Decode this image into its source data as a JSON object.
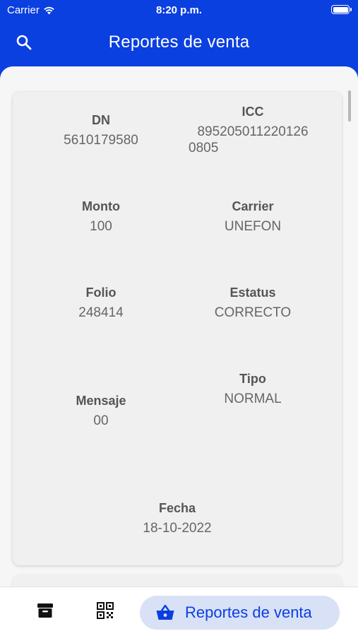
{
  "status_bar": {
    "carrier": "Carrier",
    "time": "8:20 p.m."
  },
  "app_bar": {
    "title": "Reportes de venta",
    "search_icon": "search-icon"
  },
  "report": {
    "dn": {
      "label": "DN",
      "value": "5610179580"
    },
    "icc": {
      "label": "ICC",
      "value_line1": "895205011220126",
      "value_line2": "0805"
    },
    "monto": {
      "label": "Monto",
      "value": "100"
    },
    "carrier": {
      "label": "Carrier",
      "value": "UNEFON"
    },
    "folio": {
      "label": "Folio",
      "value": "248414"
    },
    "estatus": {
      "label": "Estatus",
      "value": "CORRECTO"
    },
    "mensaje": {
      "label": "Mensaje",
      "value": "00"
    },
    "tipo": {
      "label": "Tipo",
      "value": "NORMAL"
    },
    "fecha": {
      "label": "Fecha",
      "value": "18-10-2022"
    }
  },
  "bottom_nav": {
    "items": [
      {
        "icon": "archive-box-icon"
      },
      {
        "icon": "qr-code-icon"
      },
      {
        "icon": "shopping-basket-icon",
        "label": "Reportes de venta",
        "selected": true
      }
    ]
  },
  "colors": {
    "primary": "#0a3fe0",
    "pill_bg": "#d9e1f7",
    "content_bg": "#f6f6f6"
  }
}
